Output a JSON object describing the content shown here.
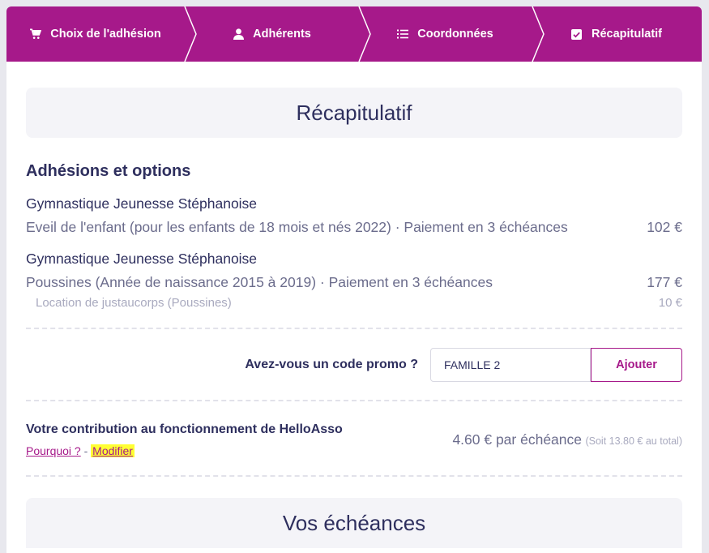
{
  "stepper": {
    "steps": [
      {
        "label": "Choix de l'adhésion",
        "icon": "cart-icon"
      },
      {
        "label": "Adhérents",
        "icon": "user-icon"
      },
      {
        "label": "Coordonnées",
        "icon": "list-icon"
      },
      {
        "label": "Récapitulatif",
        "icon": "checkbox-icon"
      }
    ]
  },
  "summary": {
    "title": "Récapitulatif",
    "section_title": "Adhésions et options",
    "items": [
      {
        "association": "Gymnastique Jeunesse Stéphanoise",
        "description": "Eveil de l'enfant (pour les enfants de 18 mois et nés 2022) · Paiement en 3 échéances",
        "price": "102 €"
      },
      {
        "association": "Gymnastique Jeunesse Stéphanoise",
        "description": "Poussines (Année de naissance 2015 à 2019) · Paiement en 3 échéances",
        "price": "177 €",
        "option": {
          "label": "Location de justaucorps (Poussines)",
          "price": "10 €"
        }
      }
    ]
  },
  "promo": {
    "label": "Avez-vous un code promo ?",
    "value": "FAMILLE 2",
    "button": "Ajouter"
  },
  "contribution": {
    "title": "Votre contribution au fonctionnement de HelloAsso",
    "why_link": "Pourquoi ?",
    "separator": "-",
    "modify_link": "Modifier",
    "amount": "4.60 € par échéance",
    "total": "(Soit 13.80 € au total)"
  },
  "schedule": {
    "title": "Vos échéances"
  },
  "colors": {
    "brand": "#a6198a",
    "text": "#2e2f5e",
    "muted": "#6b6c8c",
    "highlight": "#ffff33"
  }
}
